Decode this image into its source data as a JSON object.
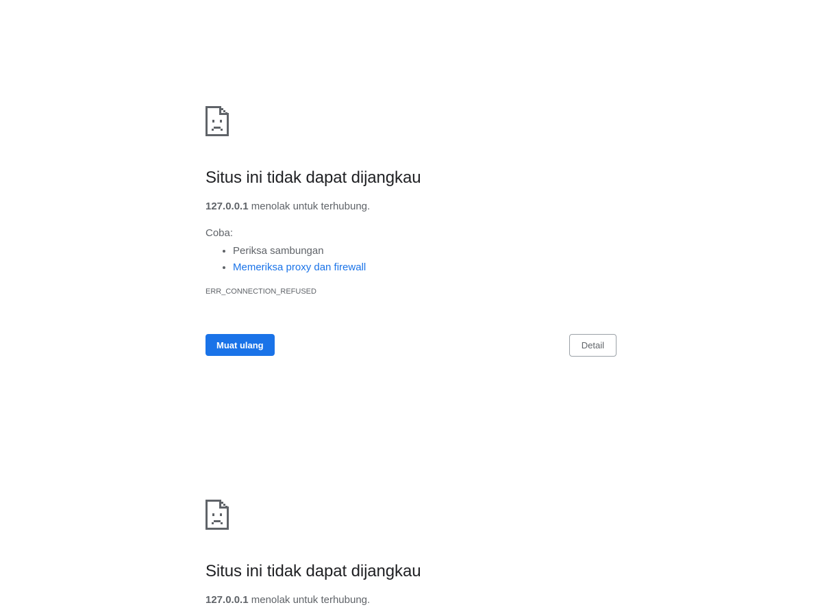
{
  "icon": "sad-page-icon",
  "colors": {
    "accent": "#1a73e8",
    "title": "#202124",
    "body": "#5f6368"
  },
  "error": {
    "title": "Situs ini tidak dapat dijangkau",
    "host": "127.0.0.1",
    "summary_suffix": " menolak untuk terhubung.",
    "try_label": "Coba:",
    "suggestions": [
      "Periksa sambungan",
      "Memeriksa proxy dan firewall"
    ],
    "code": "ERR_CONNECTION_REFUSED",
    "reload_label": "Muat ulang",
    "details_label": "Detail"
  }
}
